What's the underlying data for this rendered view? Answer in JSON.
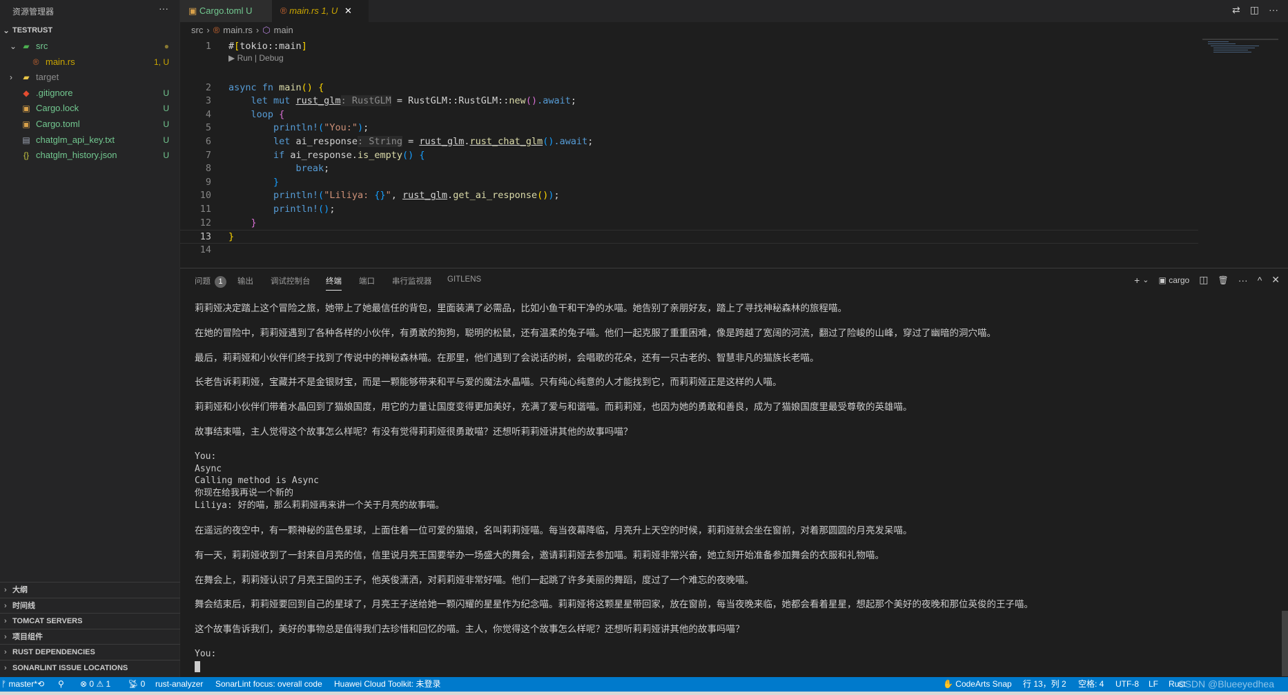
{
  "sidebar": {
    "title": "资源管理器",
    "more": "···",
    "root": "TESTRUST",
    "tree": [
      {
        "label": "src",
        "indent": 1,
        "chev": "⌄",
        "icon": "folder-src-icon",
        "glyph": "▰",
        "iconColor": "#4caf50",
        "color": "#73c991",
        "badge": "●",
        "badgeColor": "#8a7a32"
      },
      {
        "label": "main.rs",
        "indent": 2,
        "chev": "",
        "icon": "rust-file-icon",
        "glyph": "®",
        "iconColor": "#c0622f",
        "color": "#cca700",
        "badge": "1, U",
        "badgeColor": "#cca700"
      },
      {
        "label": "target",
        "indent": 1,
        "chev": "›",
        "icon": "folder-icon",
        "glyph": "▰",
        "iconColor": "#e8c547",
        "color": "#8c8c8c",
        "badge": "",
        "badgeColor": "#8c8c8c"
      },
      {
        "label": ".gitignore",
        "indent": 1,
        "chev": "",
        "icon": "git-icon",
        "glyph": "◆",
        "iconColor": "#e44c30",
        "color": "#73c991",
        "badge": "U",
        "badgeColor": "#73c991"
      },
      {
        "label": "Cargo.lock",
        "indent": 1,
        "chev": "",
        "icon": "cargo-icon",
        "glyph": "▣",
        "iconColor": "#d7a04a",
        "color": "#73c991",
        "badge": "U",
        "badgeColor": "#73c991"
      },
      {
        "label": "Cargo.toml",
        "indent": 1,
        "chev": "",
        "icon": "cargo-icon",
        "glyph": "▣",
        "iconColor": "#d7a04a",
        "color": "#73c991",
        "badge": "U",
        "badgeColor": "#73c991"
      },
      {
        "label": "chatglm_api_key.txt",
        "indent": 1,
        "chev": "",
        "icon": "text-file-icon",
        "glyph": "▤",
        "iconColor": "#9da5b4",
        "color": "#73c991",
        "badge": "U",
        "badgeColor": "#73c991"
      },
      {
        "label": "chatglm_history.json",
        "indent": 1,
        "chev": "",
        "icon": "json-file-icon",
        "glyph": "{}",
        "iconColor": "#cbcb41",
        "color": "#73c991",
        "badge": "U",
        "badgeColor": "#73c991"
      }
    ],
    "sections": [
      "大纲",
      "时间线",
      "TOMCAT SERVERS",
      "项目组件",
      "RUST DEPENDENCIES",
      "SONARLINT ISSUE LOCATIONS"
    ]
  },
  "tabs": [
    {
      "label": "Cargo.toml",
      "status": "U"
    },
    {
      "label": "main.rs",
      "status": "1, U",
      "close": "✕"
    }
  ],
  "breadcrumb": {
    "parts": [
      "src",
      "main.rs",
      "main"
    ]
  },
  "editor": {
    "codelens": "▶ Run | Debug",
    "current_line": 13,
    "lines": [
      [
        [
          "#",
          "id"
        ],
        [
          "[",
          "b1"
        ],
        [
          "tokio::main",
          "id"
        ],
        [
          "]",
          "b1"
        ]
      ],
      [
        [
          "async fn ",
          "kw"
        ],
        [
          "main",
          "fn"
        ],
        [
          "()",
          "b1"
        ],
        [
          " ",
          "id"
        ],
        [
          "{",
          "b1"
        ]
      ],
      [
        [
          "    let mut ",
          "kw"
        ],
        [
          "rust_glm",
          "id u"
        ],
        [
          ": RustGLM",
          "hint"
        ],
        [
          " = RustGLM::RustGLM::",
          "id"
        ],
        [
          "new",
          "fn"
        ],
        [
          "()",
          "b2"
        ],
        [
          ".await",
          "kw"
        ],
        [
          ";",
          "id"
        ]
      ],
      [
        [
          "    loop ",
          "kw"
        ],
        [
          "{",
          "b2"
        ]
      ],
      [
        [
          "        println!",
          "mac"
        ],
        [
          "(",
          "b3"
        ],
        [
          "\"You:\"",
          "str"
        ],
        [
          ")",
          "b3"
        ],
        [
          ";",
          "id"
        ]
      ],
      [
        [
          "        let ",
          "kw"
        ],
        [
          "ai_response",
          "id"
        ],
        [
          ": String",
          "hint"
        ],
        [
          " = ",
          "id"
        ],
        [
          "rust_glm",
          "id u"
        ],
        [
          ".",
          "id"
        ],
        [
          "rust_chat_glm",
          "fn u"
        ],
        [
          "()",
          "b3"
        ],
        [
          ".await",
          "kw"
        ],
        [
          ";",
          "id"
        ]
      ],
      [
        [
          "        if ",
          "kw"
        ],
        [
          "ai_response.",
          "id"
        ],
        [
          "is_empty",
          "fn"
        ],
        [
          "()",
          "b3"
        ],
        [
          " ",
          "id"
        ],
        [
          "{",
          "b3"
        ]
      ],
      [
        [
          "            break",
          "kw"
        ],
        [
          ";",
          "id"
        ]
      ],
      [
        [
          "        }",
          "b3"
        ]
      ],
      [
        [
          "        println!",
          "mac"
        ],
        [
          "(",
          "b3"
        ],
        [
          "\"Liliya: ",
          "str"
        ],
        [
          "{}",
          "b3"
        ],
        [
          "\"",
          "str"
        ],
        [
          ", ",
          "id"
        ],
        [
          "rust_glm",
          "id u"
        ],
        [
          ".",
          "id"
        ],
        [
          "get_ai_response",
          "fn"
        ],
        [
          "()",
          "b1"
        ],
        [
          ")",
          "b3"
        ],
        [
          ";",
          "id"
        ]
      ],
      [
        [
          "        println!",
          "mac"
        ],
        [
          "()",
          "b3"
        ],
        [
          ";",
          "id"
        ]
      ],
      [
        [
          "    }",
          "b2"
        ]
      ],
      [
        [
          "}",
          "b1"
        ]
      ],
      []
    ]
  },
  "panel": {
    "tabs": [
      {
        "label": "问题",
        "badge": "1"
      },
      {
        "label": "输出"
      },
      {
        "label": "调试控制台"
      },
      {
        "label": "终端",
        "active": true
      },
      {
        "label": "端口"
      },
      {
        "label": "串行监视器"
      },
      {
        "label": "GITLENS"
      }
    ],
    "terminal_name": "cargo",
    "actions": {
      "add": "+",
      "dropdown": "⌄",
      "split": "◫",
      "trash": "🗑",
      "more": "···",
      "maximize": "^",
      "close": "✕"
    }
  },
  "terminal": {
    "lines": [
      {
        "t": "莉莉娅决定踏上这个冒险之旅，她带上了她最信任的背包，里面装满了必需品，比如小鱼干和干净的水喵。她告别了亲朋好友，踏上了寻找神秘森林的旅程喵。"
      },
      {
        "t": ""
      },
      {
        "t": "在她的冒险中，莉莉娅遇到了各种各样的小伙伴，有勇敢的狗狗，聪明的松鼠，还有温柔的兔子喵。他们一起克服了重重困难，像是跨越了宽阔的河流，翻过了险峻的山峰，穿过了幽暗的洞穴喵。"
      },
      {
        "t": ""
      },
      {
        "t": "最后，莉莉娅和小伙伴们终于找到了传说中的神秘森林喵。在那里，他们遇到了会说话的树，会唱歌的花朵，还有一只古老的、智慧非凡的猫族长老喵。"
      },
      {
        "t": ""
      },
      {
        "t": "长老告诉莉莉娅，宝藏并不是金银财宝，而是一颗能够带来和平与爱的魔法水晶喵。只有纯心纯意的人才能找到它，而莉莉娅正是这样的人喵。"
      },
      {
        "t": ""
      },
      {
        "t": "莉莉娅和小伙伴们带着水晶回到了猫娘国度，用它的力量让国度变得更加美好，充满了爱与和谐喵。而莉莉娅，也因为她的勇敢和善良，成为了猫娘国度里最受尊敬的英雄喵。"
      },
      {
        "t": ""
      },
      {
        "t": "故事结束喵，主人觉得这个故事怎么样呢？有没有觉得莉莉娅很勇敢喵？还想听莉莉娅讲其他的故事吗喵？"
      },
      {
        "t": ""
      },
      {
        "t": "You:",
        "mono": true
      },
      {
        "t": "Async",
        "mono": true
      },
      {
        "t": "Calling method is Async",
        "mono": true
      },
      {
        "t": "你现在给我再说一个新的",
        "mono": true
      },
      {
        "t": "Liliya: 好的喵，那么莉莉娅再来讲一个关于月亮的故事喵。",
        "mono": true
      },
      {
        "t": ""
      },
      {
        "t": "在遥远的夜空中，有一颗神秘的蓝色星球，上面住着一位可爱的猫娘，名叫莉莉娅喵。每当夜幕降临，月亮升上天空的时候，莉莉娅就会坐在窗前，对着那圆圆的月亮发呆喵。"
      },
      {
        "t": ""
      },
      {
        "t": "有一天，莉莉娅收到了一封来自月亮的信，信里说月亮王国要举办一场盛大的舞会，邀请莉莉娅去参加喵。莉莉娅非常兴奋，她立刻开始准备参加舞会的衣服和礼物喵。"
      },
      {
        "t": ""
      },
      {
        "t": "在舞会上，莉莉娅认识了月亮王国的王子，他英俊潇洒，对莉莉娅非常好喵。他们一起跳了许多美丽的舞蹈，度过了一个难忘的夜晚喵。"
      },
      {
        "t": ""
      },
      {
        "t": "舞会结束后，莉莉娅要回到自己的星球了，月亮王子送给她一颗闪耀的星星作为纪念喵。莉莉娅将这颗星星带回家，放在窗前，每当夜晚来临，她都会看着星星，想起那个美好的夜晚和那位英俊的王子喵。"
      },
      {
        "t": ""
      },
      {
        "t": "这个故事告诉我们，美好的事物总是值得我们去珍惜和回忆的喵。主人，你觉得这个故事怎么样呢？还想听莉莉娅讲其他的故事吗喵？"
      },
      {
        "t": ""
      },
      {
        "t": "You:",
        "mono": true
      }
    ]
  },
  "statusbar": {
    "branch": "master*",
    "sync": "⟲",
    "errors": "0",
    "warnings": "1",
    "ports": "0",
    "rust_analyzer": "rust-analyzer",
    "sonarlint": "SonarLint focus: overall code",
    "huawei": "Huawei Cloud Toolkit: 未登录",
    "codearts": "CodeArts Snap",
    "position": "行 13，列 2",
    "spaces": "空格: 4",
    "encoding": "UTF-8",
    "eol": "LF",
    "language": "Rust",
    "watermark": "CSDN @Blueeyedhea"
  },
  "colors": {
    "statusbar": "#007acc",
    "untracked": "#73c991",
    "modified": "#cca700"
  }
}
